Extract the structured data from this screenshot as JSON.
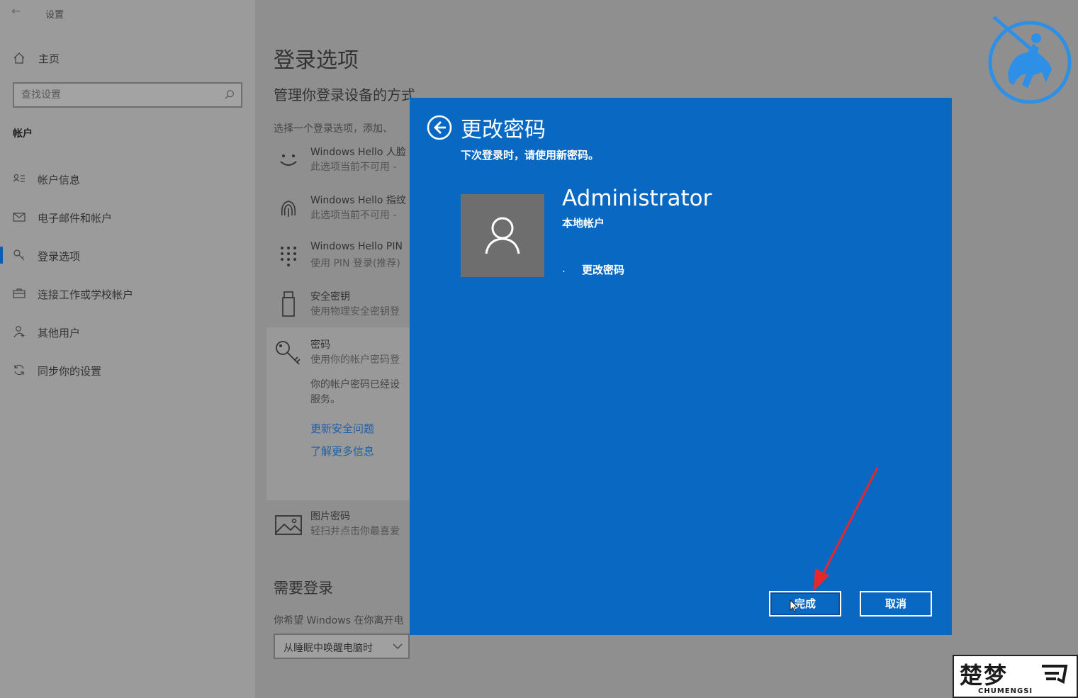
{
  "window": {
    "title": "设置",
    "back_icon": "arrow-left-icon"
  },
  "sidebar": {
    "home_label": "主页",
    "search_placeholder": "查找设置",
    "section_label": "帐户",
    "items": [
      {
        "label": "帐户信息",
        "icon": "person-list-icon",
        "active": false
      },
      {
        "label": "电子邮件和帐户",
        "icon": "mail-icon",
        "active": false
      },
      {
        "label": "登录选项",
        "icon": "key-icon",
        "active": true
      },
      {
        "label": "连接工作或学校帐户",
        "icon": "briefcase-icon",
        "active": false
      },
      {
        "label": "其他用户",
        "icon": "person-add-icon",
        "active": false
      },
      {
        "label": "同步你的设置",
        "icon": "sync-icon",
        "active": false
      }
    ]
  },
  "main": {
    "title": "登录选项",
    "subtitle": "管理你登录设备的方式",
    "description": "选择一个登录选项，添加、",
    "options": [
      {
        "title": "Windows Hello 人脸",
        "desc": "此选项当前不可用 -",
        "icon": "face-icon"
      },
      {
        "title": "Windows Hello 指纹",
        "desc": "此选项当前不可用 -",
        "icon": "fingerprint-icon"
      },
      {
        "title": "Windows Hello PIN",
        "desc": "使用 PIN 登录(推荐)",
        "icon": "pin-keypad-icon"
      },
      {
        "title": "安全密钥",
        "desc": "使用物理安全密钥登",
        "icon": "usb-key-icon"
      },
      {
        "title": "密码",
        "desc": "使用你的帐户密码登",
        "icon": "key-icon"
      },
      {
        "title": "图片密码",
        "desc": "轻扫并点击你最喜爱",
        "icon": "picture-icon"
      }
    ],
    "password_note_line1": "你的帐户密码已经设",
    "password_note_line2": "服务。",
    "links": [
      "更新安全问题",
      "了解更多信息"
    ],
    "require_login_title": "需要登录",
    "require_login_desc": "你希望 Windows 在你离开电",
    "require_login_select": "从睡眠中唤醒电脑时"
  },
  "dialog": {
    "title": "更改密码",
    "subtitle": "下次登录时，请使用新密码。",
    "user_name": "Administrator",
    "account_type": "本地帐户",
    "bullet": ".",
    "item": "更改密码",
    "finish_button": "完成",
    "cancel_button": "取消"
  },
  "watermark": {
    "brand_cn": "楚梦",
    "brand_en": "CHUMENGSI"
  },
  "colors": {
    "dialog_bg": "#0868c2",
    "overlay_gray": "#8f8f8f",
    "annotation_arrow": "#e8262b"
  }
}
